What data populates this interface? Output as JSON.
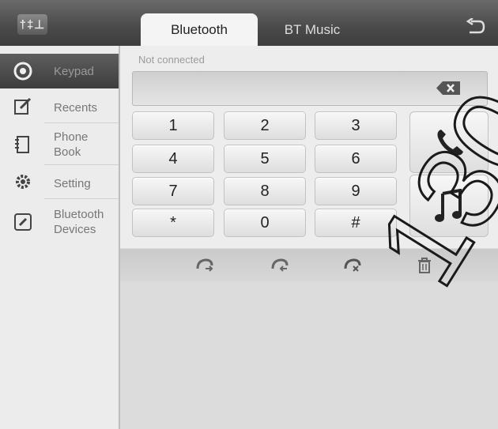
{
  "header": {
    "eq_icon_text": "†‡⊥",
    "tabs": [
      {
        "label": "Bluetooth",
        "active": true
      },
      {
        "label": "BT Music",
        "active": false
      }
    ]
  },
  "sidebar": {
    "items": [
      {
        "label": "Keypad",
        "icon": "keypad-icon",
        "active": true
      },
      {
        "label": "Recents",
        "icon": "recents-icon"
      },
      {
        "label": "Phone\nBook",
        "icon": "phonebook-icon"
      },
      {
        "label": "Setting",
        "icon": "gear-icon"
      },
      {
        "label": "Bluetooth\nDevices",
        "icon": "link-icon"
      }
    ]
  },
  "dialer": {
    "status": "Not connected",
    "number": "",
    "keys": [
      [
        "1",
        "2",
        "3"
      ],
      [
        "4",
        "5",
        "6"
      ],
      [
        "7",
        "8",
        "9"
      ],
      [
        "*",
        "0",
        "#"
      ]
    ]
  },
  "watermark": "130",
  "colors": {
    "topbar": "#4a4a4a",
    "active_tab": "#f4f4f4",
    "sidebar": "#ececec",
    "panel": "#ededed"
  }
}
